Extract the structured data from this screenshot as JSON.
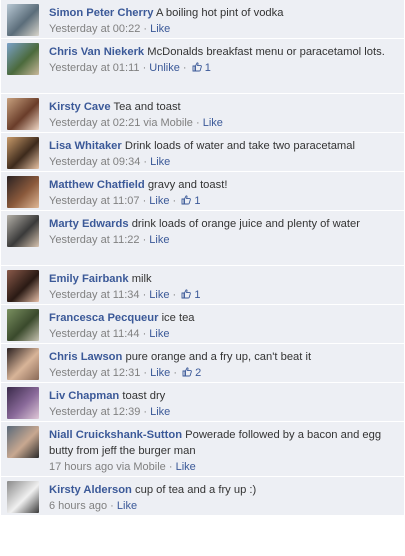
{
  "comments": [
    {
      "author": "Simon Peter Cherry",
      "text": "A boiling hot pint of vodka",
      "time": "Yesterday at 00:22",
      "via": "",
      "like": "Like",
      "unlike": "",
      "likes": "",
      "height": 39,
      "avatar_colors": [
        "#b8c8d4",
        "#5b6d7a",
        "#d9d6cc"
      ]
    },
    {
      "author": "Chris Van Niekerk",
      "text": "McDonalds breakfast menu or paracetamol lots.",
      "time": "Yesterday at 01:11",
      "via": "",
      "like": "",
      "unlike": "Unlike",
      "likes": "1",
      "height": 55,
      "avatar_colors": [
        "#7aa1c8",
        "#4b6a3c",
        "#c9b89a"
      ]
    },
    {
      "author": "Kirsty Cave",
      "text": "Tea and toast",
      "time": "Yesterday at 02:21",
      "via": "via Mobile",
      "like": "Like",
      "unlike": "",
      "likes": "",
      "height": 39,
      "avatar_colors": [
        "#c7a07e",
        "#6a3d2a",
        "#f0d8c6"
      ]
    },
    {
      "author": "Lisa Whitaker",
      "text": "Drink loads of water and take two paracetamal",
      "time": "Yesterday at 09:34",
      "via": "",
      "like": "Like",
      "unlike": "",
      "likes": "",
      "height": 39,
      "avatar_colors": [
        "#c89a6a",
        "#3d2a1c",
        "#e7c2a3"
      ]
    },
    {
      "author": "Matthew Chatfield",
      "text": "gravy and toast!",
      "time": "Yesterday at 11:07",
      "via": "",
      "like": "Like",
      "unlike": "",
      "likes": "1",
      "height": 39,
      "avatar_colors": [
        "#2a2222",
        "#8b5a3c",
        "#e0b896"
      ]
    },
    {
      "author": "Marty Edwards",
      "text": "drink loads of orange juice and plenty of water",
      "time": "Yesterday at 11:22",
      "via": "",
      "like": "Like",
      "unlike": "",
      "likes": "",
      "height": 55,
      "avatar_colors": [
        "#b4b0a8",
        "#3a3a3a",
        "#d8c4b0"
      ]
    },
    {
      "author": "Emily Fairbank",
      "text": "milk",
      "time": "Yesterday at 11:34",
      "via": "",
      "like": "Like",
      "unlike": "",
      "likes": "1",
      "height": 39,
      "avatar_colors": [
        "#8a5a4a",
        "#2a1a14",
        "#e6bfa8"
      ]
    },
    {
      "author": "Francesca Pecqueur",
      "text": "ice tea",
      "time": "Yesterday at 11:44",
      "via": "",
      "like": "Like",
      "unlike": "",
      "likes": "",
      "height": 39,
      "avatar_colors": [
        "#7a9060",
        "#3a4a2c",
        "#c6c2b0"
      ]
    },
    {
      "author": "Chris Lawson",
      "text": "pure orange and a fry up, can't beat it",
      "time": "Yesterday at 12:31",
      "via": "",
      "like": "Like",
      "unlike": "",
      "likes": "2",
      "height": 39,
      "avatar_colors": [
        "#2a2020",
        "#d8b498",
        "#8a6a58"
      ]
    },
    {
      "author": "Liv Chapman",
      "text": "toast dry",
      "time": "Yesterday at 12:39",
      "via": "",
      "like": "Like",
      "unlike": "",
      "likes": "",
      "height": 39,
      "avatar_colors": [
        "#3a2a4a",
        "#8a6a9a",
        "#e0c8d8"
      ]
    },
    {
      "author": "Niall Cruickshank-Sutton",
      "text": "Powerade followed by a bacon and egg butty from jeff the burger man",
      "time": "17 hours ago",
      "via": "via Mobile",
      "like": "Like",
      "unlike": "",
      "likes": "",
      "height": 55,
      "avatar_colors": [
        "#5a6a7a",
        "#c8a890",
        "#2a2a2a"
      ]
    },
    {
      "author": "Kirsty Alderson",
      "text": "cup of tea and a fry up :)",
      "time": "6 hours ago",
      "via": "",
      "like": "Like",
      "unlike": "",
      "likes": "",
      "height": 39,
      "avatar_colors": [
        "#8a8a8a",
        "#f0f0f0",
        "#3a3a3a"
      ]
    }
  ]
}
